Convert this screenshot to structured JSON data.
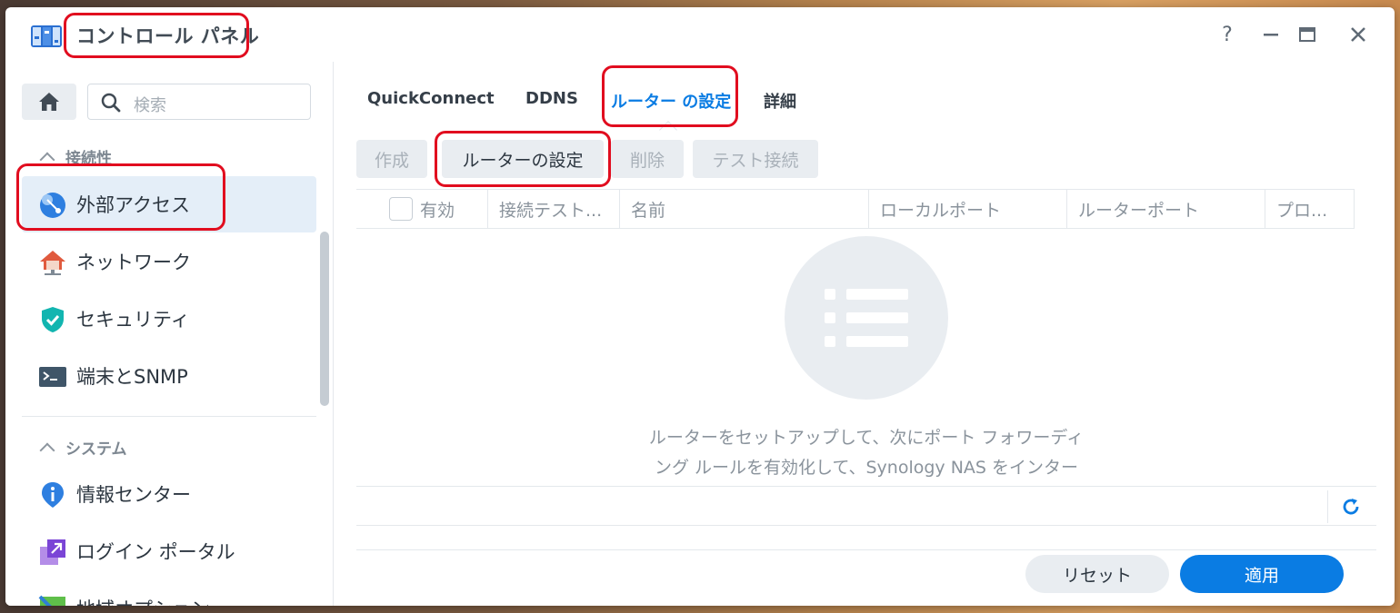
{
  "window": {
    "title": "コントロール パネル",
    "help_icon": "help-icon",
    "minimize_icon": "minimize-icon",
    "maximize_icon": "maximize-icon",
    "close_icon": "close-icon"
  },
  "sidebar": {
    "search": {
      "placeholder": "検索"
    },
    "sections": [
      {
        "header": "接続性",
        "items": [
          {
            "label": "外部アクセス",
            "icon": "external-access-icon",
            "active": true
          },
          {
            "label": "ネットワーク",
            "icon": "network-icon"
          },
          {
            "label": "セキュリティ",
            "icon": "security-shield-icon"
          },
          {
            "label": "端末とSNMP",
            "icon": "terminal-icon"
          }
        ]
      },
      {
        "header": "システム",
        "items": [
          {
            "label": "情報センター",
            "icon": "info-center-icon"
          },
          {
            "label": "ログイン ポータル",
            "icon": "login-portal-icon"
          },
          {
            "label": "地域オプション",
            "icon": "regional-options-icon"
          }
        ]
      }
    ]
  },
  "main": {
    "tabs": [
      {
        "label": "QuickConnect"
      },
      {
        "label": "DDNS"
      },
      {
        "label": "ルーター の設定",
        "active": true
      },
      {
        "label": "詳細"
      }
    ],
    "toolbar": {
      "create": "作成",
      "router_settings": "ルーターの設定",
      "delete": "削除",
      "test_connection": "テスト接続"
    },
    "table": {
      "columns": [
        "有効",
        "接続テスト...",
        "名前",
        "ローカルポート",
        "ルーターポート",
        "プロ..."
      ]
    },
    "empty_message_line1": "ルーターをセットアップして、次にポート フォワーディ",
    "empty_message_line2": "ング ルールを有効化して、Synology NAS をインター",
    "buttons": {
      "reset": "リセット",
      "apply": "適用"
    }
  },
  "colors": {
    "accent": "#0a7ce3",
    "highlight_annotation": "#e10d1f",
    "active_nav_bg": "#e4eef8"
  }
}
